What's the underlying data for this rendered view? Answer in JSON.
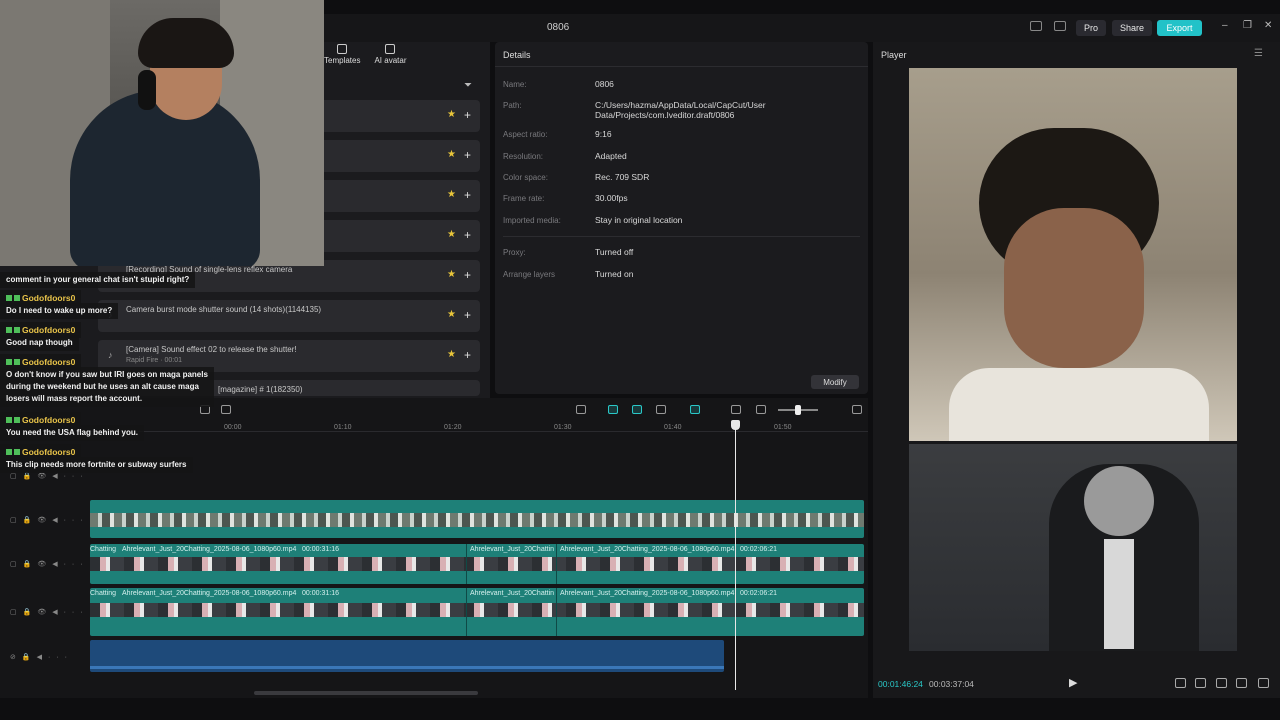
{
  "window": {
    "title": "0806"
  },
  "toolbar": {
    "pro_label": "Pro",
    "share_label": "Share",
    "export_label": "Export",
    "minimize": "–",
    "maximize": "❐",
    "close": "✕"
  },
  "media_tabs": [
    {
      "label": "Templates",
      "icon": "templates-icon"
    },
    {
      "label": "AI avatar",
      "icon": "ai-avatar-icon"
    }
  ],
  "media_rows": [
    {
      "name": "",
      "sub": ""
    },
    {
      "name": "",
      "sub": ""
    },
    {
      "name": "",
      "sub": ""
    },
    {
      "name": "",
      "sub": ""
    },
    {
      "name": "[Recording] Sound of single-lens reflex camera",
      "sub": ""
    },
    {
      "name": "Camera burst mode shutter sound (14 shots)(1144135)",
      "sub": ""
    },
    {
      "name": "[Camera] Sound effect 02 to release the shutter!",
      "sub": "Rapid Fire · 00:01"
    },
    {
      "name": "[magazine] # 1(182350)",
      "sub": ""
    }
  ],
  "chat": [
    {
      "type": "msg",
      "lines": [
        "comment in your general chat isn't stupid right?"
      ]
    },
    {
      "type": "user",
      "name": "Godofdoors0"
    },
    {
      "type": "msg",
      "lines": [
        "Do I need to wake up more?"
      ]
    },
    {
      "type": "user",
      "name": "Godofdoors0"
    },
    {
      "type": "msg",
      "lines": [
        "Good nap though"
      ]
    },
    {
      "type": "user",
      "name": "Godofdoors0"
    },
    {
      "type": "msg",
      "lines": [
        "O don't know if you saw but IRI goes on maga panels",
        "during the weekend but he uses an alt cause maga",
        "losers will mass report the account."
      ]
    },
    {
      "type": "user",
      "name": "Godofdoors0"
    },
    {
      "type": "msg",
      "lines": [
        "You need the USA flag behind you."
      ]
    },
    {
      "type": "user",
      "name": "Godofdoors0"
    },
    {
      "type": "msg",
      "lines": [
        "This clip needs more fortnite or subway surfers"
      ]
    }
  ],
  "details": {
    "title": "Details",
    "fields": [
      {
        "label": "Name:",
        "value": "0806"
      },
      {
        "label": "Path:",
        "value": "C:/Users/hazma/AppData/Local/CapCut/User Data/Projects/com.lveditor.draft/0806"
      },
      {
        "label": "Aspect ratio:",
        "value": "9:16"
      },
      {
        "label": "Resolution:",
        "value": "Adapted"
      },
      {
        "label": "Color space:",
        "value": "Rec. 709 SDR"
      },
      {
        "label": "Frame rate:",
        "value": "30.00fps"
      },
      {
        "label": "Imported media:",
        "value": "Stay in original location"
      }
    ],
    "extra_fields": [
      {
        "label": "Proxy:",
        "value": "Turned off"
      },
      {
        "label": "Arrange layers",
        "value": "Turned on"
      }
    ],
    "modify_label": "Modify"
  },
  "player": {
    "title": "Player",
    "current_time": "00:01:46:24",
    "total_time": "00:03:37:04",
    "play_icon": "▶"
  },
  "timeline": {
    "ticks": [
      "00:00",
      "01:10",
      "01:20",
      "01:30",
      "01:40",
      "01:50"
    ],
    "clips_row1": {
      "a": "Chatting",
      "b": "Ahrelevant_Just_20Chatting_2025-08-06_1080p60.mp4",
      "b_dur": "00:00:31:16",
      "c": "Ahrelevant_Just_20Chattin",
      "d": "Ahrelevant_Just_20Chatting_2025-08-06_1080p60.mp4",
      "d_dur": "00:02:06:21"
    },
    "clips_row2": {
      "a": "Chatting",
      "b": "Ahrelevant_Just_20Chatting_2025-08-06_1080p60.mp4",
      "b_dur": "00:00:31:16",
      "c": "Ahrelevant_Just_20Chattin",
      "d": "Ahrelevant_Just_20Chatting_2025-08-06_1080p60.mp4",
      "d_dur": "00:02:06:21"
    }
  },
  "colors": {
    "accent": "#22c2c8",
    "clip": "#1e8078",
    "audio": "#1e4a7a",
    "chat_user": "#e9c44a"
  }
}
